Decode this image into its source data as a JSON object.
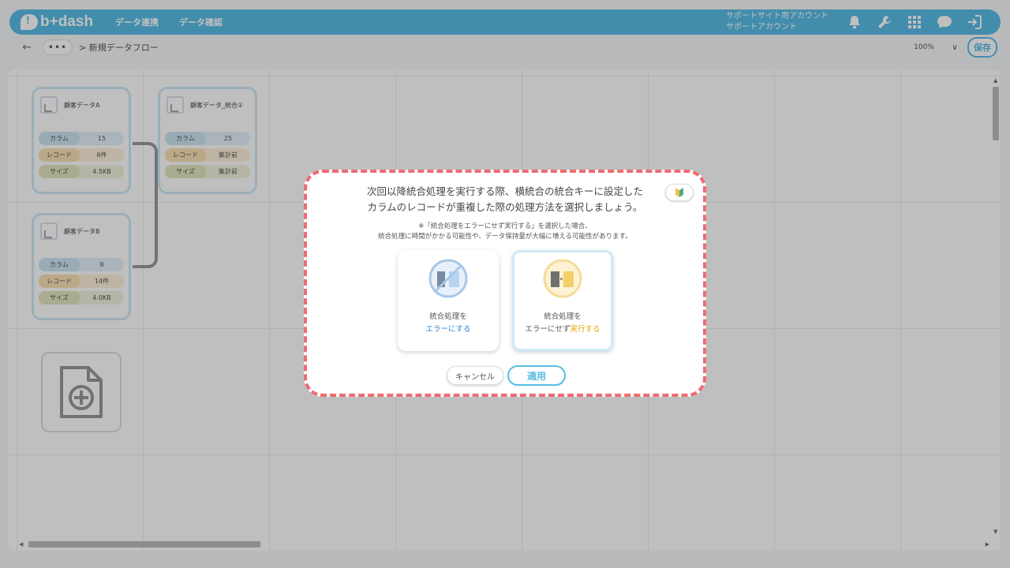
{
  "header": {
    "logo_text": "b+dash",
    "nav": [
      "データ連携",
      "データ確認"
    ],
    "account_line1": "サポートサイト用アカウント",
    "account_line2": "サポートアカウント",
    "icons": [
      "bell-icon",
      "wrench-icon",
      "grid-icon",
      "chat-icon",
      "logout-icon"
    ]
  },
  "toolbar": {
    "back": "←",
    "more": "•••",
    "breadcrumb": "> 新規データフロー",
    "zoom": "100%",
    "zoom_chevron": "∨",
    "save_label": "保存"
  },
  "canvas": {
    "cards": [
      {
        "title": "顧客データA",
        "rows": [
          {
            "key": "カラム",
            "value": "15"
          },
          {
            "key": "レコード",
            "value": "6件"
          },
          {
            "key": "サイズ",
            "value": "4.5KB"
          }
        ]
      },
      {
        "title": "顧客データ_統合①",
        "rows": [
          {
            "key": "カラム",
            "value": "25"
          },
          {
            "key": "レコード",
            "value": "集計前"
          },
          {
            "key": "サイズ",
            "value": "集計前"
          }
        ]
      },
      {
        "title": "顧客データB",
        "rows": [
          {
            "key": "カラム",
            "value": "8"
          },
          {
            "key": "レコード",
            "value": "14件"
          },
          {
            "key": "サイズ",
            "value": "4.0KB"
          }
        ]
      }
    ]
  },
  "modal": {
    "question_line1": "次回以降統合処理を実行する際、横統合の統合キーに設定した",
    "question_line2": "カラムのレコードが重複した際の処理方法を選択しましょう。",
    "note_line1": "※「統合処理をエラーにせず実行する」を選択した場合、",
    "note_line2": "統合処理に時間がかかる可能性や、データ保持量が大幅に増える可能性があります。",
    "option1": {
      "line1": "統合処理を",
      "line2": "エラーにする",
      "selected": false
    },
    "option2": {
      "line1": "統合処理を",
      "line2_plain": "エラーにせず",
      "line2_accent": "実行する",
      "selected": true
    },
    "cancel_label": "キャンセル",
    "apply_label": "適用",
    "colors": {
      "border": "#ef6b73",
      "accent_blue": "#2a86d1",
      "accent_gold": "#e6a400",
      "brand": "#58bde6"
    }
  }
}
